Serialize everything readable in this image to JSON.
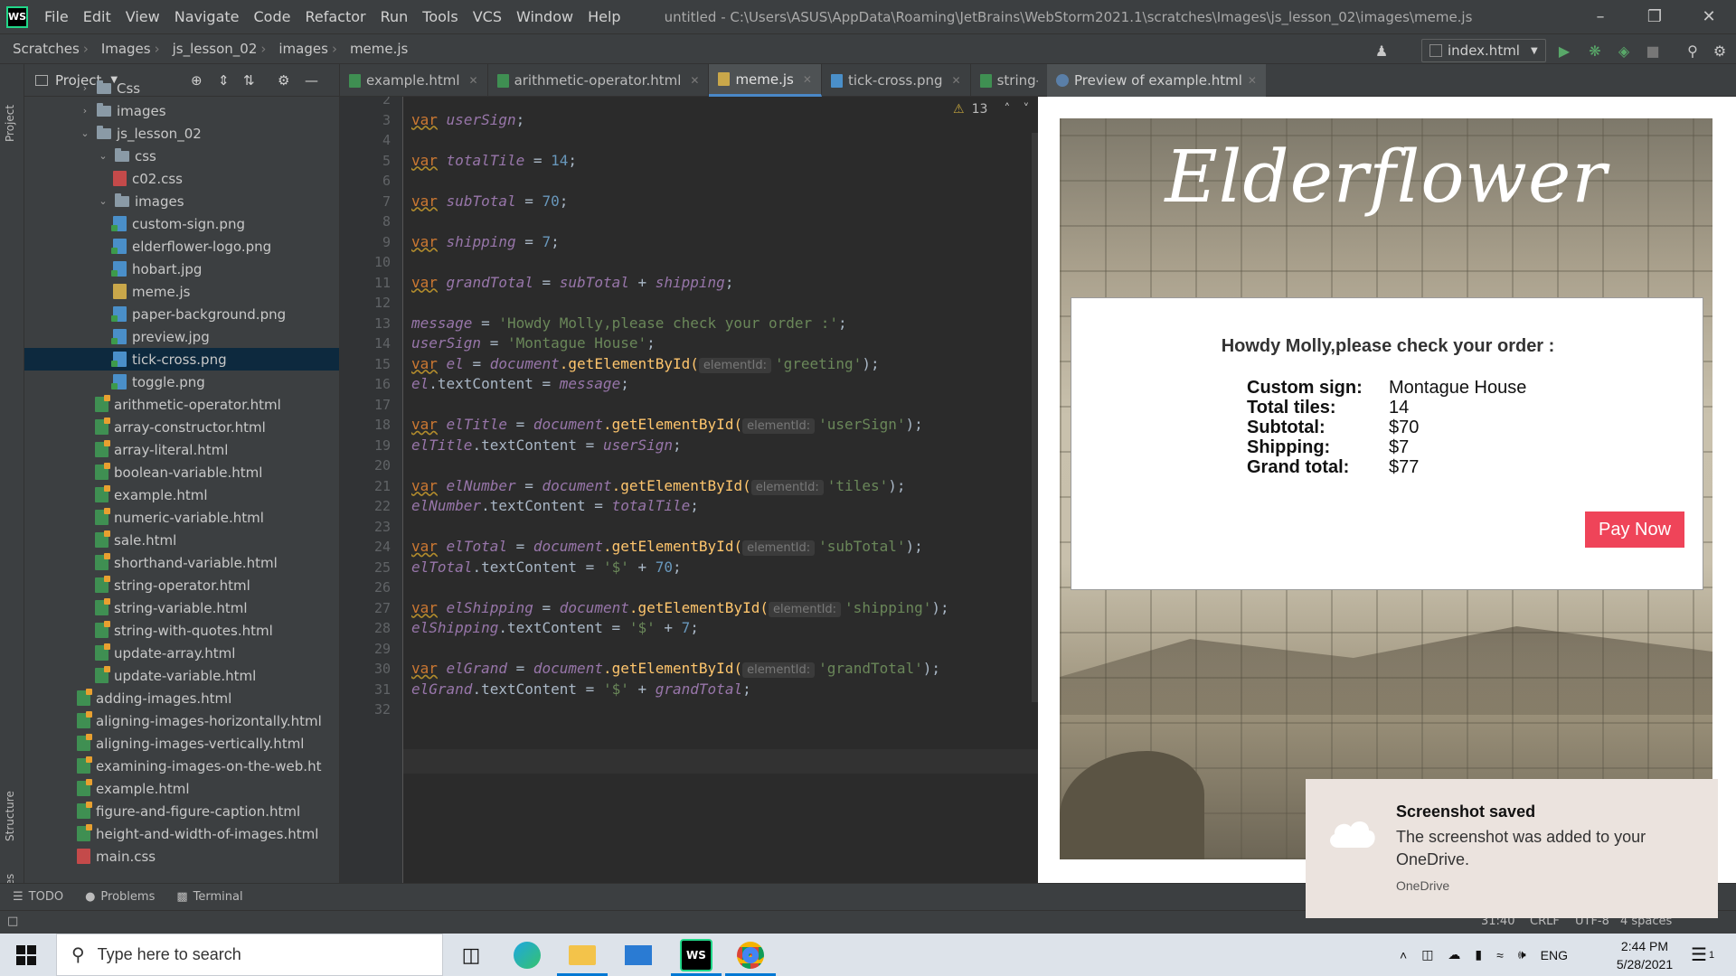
{
  "titlebar": {
    "menu": [
      "File",
      "Edit",
      "View",
      "Navigate",
      "Code",
      "Refactor",
      "Run",
      "Tools",
      "VCS",
      "Window",
      "Help"
    ],
    "title": "untitled - C:\\Users\\ASUS\\AppData\\Roaming\\JetBrains\\WebStorm2021.1\\scratches\\Images\\js_lesson_02\\images\\meme.js"
  },
  "breadcrumbs": [
    "Scratches",
    "Images",
    "js_lesson_02",
    "images",
    "meme.js"
  ],
  "run_config": "index.html",
  "project_panel": {
    "title": "Project",
    "tree": [
      {
        "label": "Css",
        "kind": "folder",
        "arrow": "›"
      },
      {
        "label": "images",
        "kind": "folder",
        "arrow": "›"
      },
      {
        "label": "js_lesson_02",
        "kind": "folder",
        "arrow": "⌄"
      },
      {
        "label": "css",
        "kind": "folder",
        "arrow": "⌄"
      },
      {
        "label": "c02.css",
        "kind": "css"
      },
      {
        "label": "images",
        "kind": "folder",
        "arrow": "⌄"
      },
      {
        "label": "custom-sign.png",
        "kind": "img"
      },
      {
        "label": "elderflower-logo.png",
        "kind": "img"
      },
      {
        "label": "hobart.jpg",
        "kind": "img"
      },
      {
        "label": "meme.js",
        "kind": "js"
      },
      {
        "label": "paper-background.png",
        "kind": "img"
      },
      {
        "label": "preview.jpg",
        "kind": "img"
      },
      {
        "label": "tick-cross.png",
        "kind": "img",
        "selected": true
      },
      {
        "label": "toggle.png",
        "kind": "img"
      },
      {
        "label": "arithmetic-operator.html",
        "kind": "html"
      },
      {
        "label": "array-constructor.html",
        "kind": "html"
      },
      {
        "label": "array-literal.html",
        "kind": "html"
      },
      {
        "label": "boolean-variable.html",
        "kind": "html"
      },
      {
        "label": "example.html",
        "kind": "html"
      },
      {
        "label": "numeric-variable.html",
        "kind": "html"
      },
      {
        "label": "sale.html",
        "kind": "html"
      },
      {
        "label": "shorthand-variable.html",
        "kind": "html"
      },
      {
        "label": "string-operator.html",
        "kind": "html"
      },
      {
        "label": "string-variable.html",
        "kind": "html"
      },
      {
        "label": "string-with-quotes.html",
        "kind": "html"
      },
      {
        "label": "update-array.html",
        "kind": "html"
      },
      {
        "label": "update-variable.html",
        "kind": "html"
      },
      {
        "label": "adding-images.html",
        "kind": "html"
      },
      {
        "label": "aligning-images-horizontally.html",
        "kind": "html"
      },
      {
        "label": "aligning-images-vertically.html",
        "kind": "html"
      },
      {
        "label": "examining-images-on-the-web.ht",
        "kind": "html"
      },
      {
        "label": "example.html",
        "kind": "html"
      },
      {
        "label": "figure-and-figure-caption.html",
        "kind": "html"
      },
      {
        "label": "height-and-width-of-images.html",
        "kind": "html"
      },
      {
        "label": "main.css",
        "kind": "css"
      }
    ]
  },
  "left_strip": {
    "project": "Project",
    "structure": "Structure",
    "favorites": "Favorites"
  },
  "editor_tabs": [
    {
      "label": "example.html",
      "kind": "html"
    },
    {
      "label": "arithmetic-operator.html",
      "kind": "html"
    },
    {
      "label": "meme.js",
      "kind": "js",
      "active": true
    },
    {
      "label": "tick-cross.png",
      "kind": "img"
    },
    {
      "label": "string-v",
      "kind": "html"
    }
  ],
  "editor": {
    "warnings": "13",
    "line_numbers": [
      "2",
      "3",
      "4",
      "5",
      "6",
      "7",
      "8",
      "9",
      "10",
      "11",
      "12",
      "13",
      "14",
      "15",
      "16",
      "17",
      "18",
      "19",
      "20",
      "21",
      "22",
      "23",
      "24",
      "25",
      "26",
      "27",
      "28",
      "29",
      "30",
      "31",
      "32"
    ],
    "code": {
      "l3": {
        "kw": "var",
        "name": "userSign",
        "end": ";"
      },
      "l5": {
        "kw": "var",
        "name": "totalTile",
        "op": " = ",
        "num": "14",
        "end": ";"
      },
      "l7": {
        "kw": "var",
        "name": "subTotal",
        "op": " = ",
        "num": "70",
        "end": ";"
      },
      "l9": {
        "kw": "var",
        "name": "shipping",
        "op": " = ",
        "num": "7",
        "end": ";"
      },
      "l11": {
        "kw": "var",
        "name": "grandTotal",
        "op": " = ",
        "a": "subTotal",
        "plus": " + ",
        "b": "shipping",
        "end": ";"
      },
      "l13": {
        "name": "message",
        "op": " = ",
        "str": "'Howdy Molly,please check your order :'",
        "end": ";"
      },
      "l14": {
        "name": "userSign",
        "op": " = ",
        "str": "'Montague House'",
        "end": ";"
      },
      "l15": {
        "kw": "var",
        "name": "el",
        "op": " = ",
        "doc": "document",
        "fn": ".getElementById(",
        "hint": "elementId:",
        "str": "'greeting'",
        "end": ");"
      },
      "l16": {
        "name": "el",
        "prop": ".textContent",
        "op": " = ",
        "val": "message",
        "end": ";"
      },
      "l18": {
        "kw": "var",
        "name": "elTitle",
        "op": " = ",
        "doc": "document",
        "fn": ".getElementById(",
        "hint": "elementId:",
        "str": "'userSign'",
        "end": ");"
      },
      "l19": {
        "name": "elTitle",
        "prop": ".textContent",
        "op": " = ",
        "val": "userSign",
        "end": ";"
      },
      "l21": {
        "kw": "var",
        "name": "elNumber",
        "op": " = ",
        "doc": "document",
        "fn": ".getElementById(",
        "hint": "elementId:",
        "str": "'tiles'",
        "end": ");"
      },
      "l22": {
        "name": "elNumber",
        "prop": ".textContent",
        "op": " = ",
        "val": "totalTile",
        "end": ";"
      },
      "l24": {
        "kw": "var",
        "name": "elTotal",
        "op": " = ",
        "doc": "document",
        "fn": ".getElementById(",
        "hint": "elementId:",
        "str": "'subTotal'",
        "end": ");"
      },
      "l25": {
        "name": "elTotal",
        "prop": ".textContent",
        "op": " = ",
        "str": "'$'",
        "plus": " + ",
        "num": "70",
        "end": ";"
      },
      "l27": {
        "kw": "var",
        "name": "elShipping",
        "op": " = ",
        "doc": "document",
        "fn": ".getElementById(",
        "hint": "elementId:",
        "str": "'shipping'",
        "end": ");"
      },
      "l28": {
        "name": "elShipping",
        "prop": ".textContent",
        "op": " = ",
        "str": "'$'",
        "plus": " + ",
        "num": "7",
        "end": ";"
      },
      "l30": {
        "kw": "var",
        "name": "elGrand",
        "op": " = ",
        "doc": "document",
        "fn": ".getElementById(",
        "hint": "elementId:",
        "str": "'grandTotal'",
        "end": ");"
      },
      "l31": {
        "name": "elGrand",
        "prop": ".textContent",
        "op": " = ",
        "str": "'$'",
        "plus": " + ",
        "val": "grandTotal",
        "end": ";"
      }
    }
  },
  "preview": {
    "tab_label": "Preview of example.html",
    "logo_text": "Elderflower",
    "greeting": "Howdy Molly,please check your order :",
    "rows": [
      {
        "label": "Custom sign:",
        "value": "Montague House"
      },
      {
        "label": "Total tiles:",
        "value": "14"
      },
      {
        "label": "Subtotal:",
        "value": "$70"
      },
      {
        "label": "Shipping:",
        "value": "$7"
      },
      {
        "label": "Grand total:",
        "value": "$77"
      }
    ],
    "pay_button": "Pay Now",
    "pay_color": "#ef4459"
  },
  "toast": {
    "title": "Screenshot saved",
    "body": "The screenshot was added to your OneDrive.",
    "source": "OneDrive"
  },
  "bottom_tabs": [
    "TODO",
    "Problems",
    "Terminal"
  ],
  "status": {
    "pos": "31:40",
    "eol": "CRLF",
    "enc": "UTF-8",
    "indent": "4 spaces"
  },
  "taskbar": {
    "search_placeholder": "Type here to search",
    "lang": "ENG",
    "time": "2:44 PM",
    "date": "5/28/2021",
    "notif_count": "1"
  }
}
